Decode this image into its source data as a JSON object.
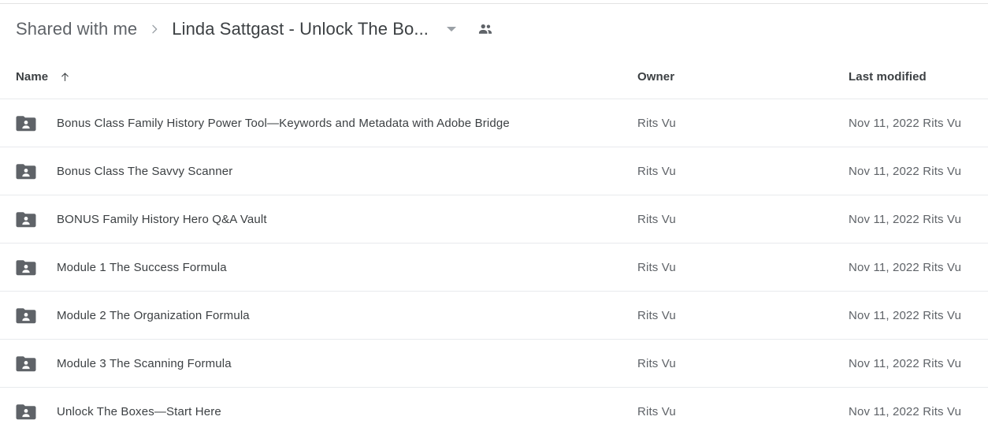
{
  "breadcrumb": {
    "parent_label": "Shared with me",
    "separator_icon": "chevron-right-icon",
    "current_label": "Linda Sattgast - Unlock The Bo...",
    "caret_icon": "chevron-down-icon",
    "people_icon": "people-icon"
  },
  "columns": {
    "name": "Name",
    "owner": "Owner",
    "last_modified": "Last modified",
    "sort_icon": "arrow-up-icon"
  },
  "colors": {
    "text_primary": "#3c4043",
    "text_secondary": "#5f6368",
    "icon_gray": "#5f6368",
    "divider": "#e8eaed",
    "background": "#ffffff"
  },
  "rows": [
    {
      "icon": "shared-folder-icon",
      "name": "Bonus Class Family History Power Tool—Keywords and Metadata with Adobe Bridge",
      "owner": "Rits Vu",
      "last_modified": "Nov 11, 2022 Rits Vu"
    },
    {
      "icon": "shared-folder-icon",
      "name": "Bonus Class The Savvy Scanner",
      "owner": "Rits Vu",
      "last_modified": "Nov 11, 2022 Rits Vu"
    },
    {
      "icon": "shared-folder-icon",
      "name": "BONUS Family History Hero Q&A Vault",
      "owner": "Rits Vu",
      "last_modified": "Nov 11, 2022 Rits Vu"
    },
    {
      "icon": "shared-folder-icon",
      "name": "Module 1 The Success Formula",
      "owner": "Rits Vu",
      "last_modified": "Nov 11, 2022 Rits Vu"
    },
    {
      "icon": "shared-folder-icon",
      "name": "Module 2 The Organization Formula",
      "owner": "Rits Vu",
      "last_modified": "Nov 11, 2022 Rits Vu"
    },
    {
      "icon": "shared-folder-icon",
      "name": "Module 3 The Scanning Formula",
      "owner": "Rits Vu",
      "last_modified": "Nov 11, 2022 Rits Vu"
    },
    {
      "icon": "shared-folder-icon",
      "name": "Unlock The Boxes—Start Here",
      "owner": "Rits Vu",
      "last_modified": "Nov 11, 2022 Rits Vu"
    }
  ]
}
